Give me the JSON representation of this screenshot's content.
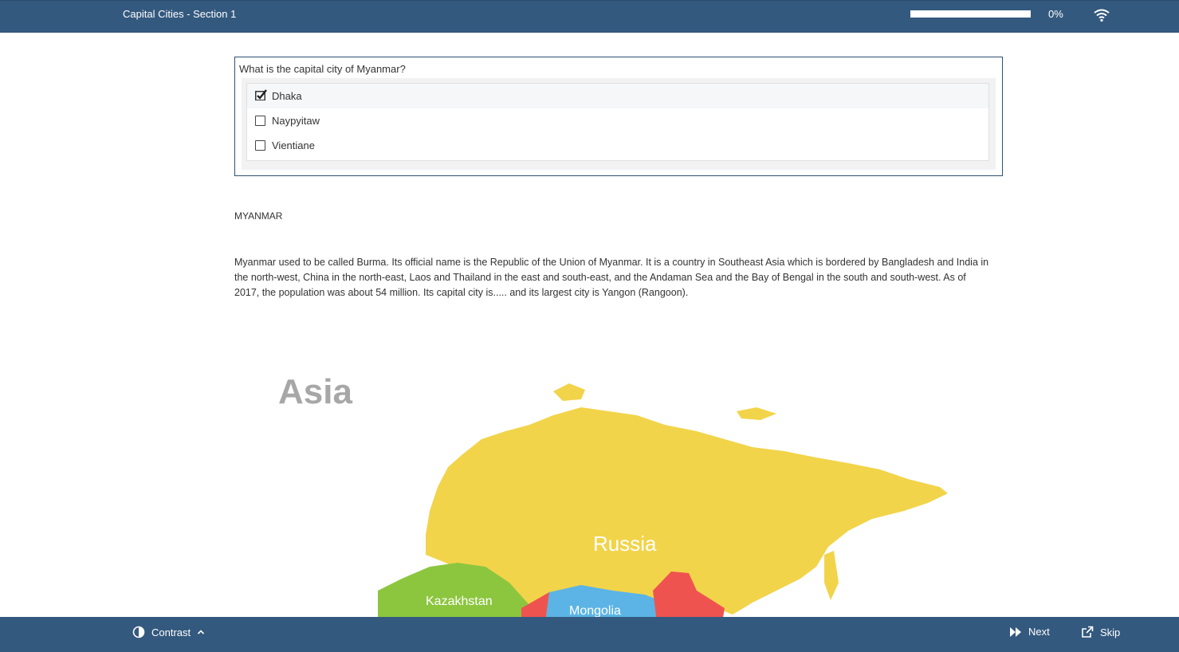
{
  "header": {
    "title": "Capital Cities - Section 1",
    "progress_percent": 0,
    "progress_label": "0%",
    "status_icon": "wifi-icon"
  },
  "question": {
    "text": "What is the capital city of Myanmar?",
    "options": [
      {
        "label": "Dhaka",
        "checked": true
      },
      {
        "label": "Naypyitaw",
        "checked": false
      },
      {
        "label": "Vientiane",
        "checked": false
      }
    ]
  },
  "article": {
    "heading": "MYANMAR",
    "body": "Myanmar used to be called Burma. Its official name is the Republic of the Union of Myanmar. It is a country in Southeast Asia which is bordered by Bangladesh and India in the north-west, China in the north-east, Laos and Thailand in the east and south-east, and the Andaman Sea and the Bay of Bengal in the south and south-west. As of 2017, the population was about 54 million. Its capital city is..... and its largest city is Yangon (Rangoon)."
  },
  "map": {
    "title": "Asia",
    "labels": {
      "russia": "Russia",
      "kazakhstan": "Kazakhstan",
      "mongolia": "Mongolia"
    },
    "colors": {
      "russia": "#f2d44a",
      "kazakhstan": "#8cc63f",
      "mongolia": "#5bb4e5",
      "china": "#ef5350",
      "title": "#a7a7a7"
    }
  },
  "footer": {
    "contrast_label": "Contrast",
    "next_label": "Next",
    "skip_label": "Skip"
  },
  "colors": {
    "bar": "#34597e",
    "border": "#2e5070"
  }
}
